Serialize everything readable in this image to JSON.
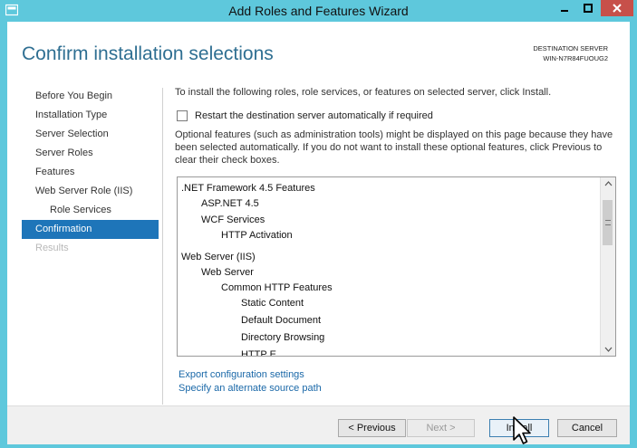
{
  "window": {
    "title": "Add Roles and Features Wizard"
  },
  "header": {
    "heading": "Confirm installation selections",
    "destination_label": "DESTINATION SERVER",
    "destination_server": "WIN-N7R84FUOUG2"
  },
  "nav": {
    "items": [
      {
        "label": "Before You Begin"
      },
      {
        "label": "Installation Type"
      },
      {
        "label": "Server Selection"
      },
      {
        "label": "Server Roles"
      },
      {
        "label": "Features"
      },
      {
        "label": "Web Server Role (IIS)"
      },
      {
        "label": "Role Services"
      },
      {
        "label": "Confirmation"
      },
      {
        "label": "Results"
      }
    ]
  },
  "content": {
    "intro": "To install the following roles, role services, or features on selected server, click Install.",
    "restart_checkbox_label": "Restart the destination server automatically if required",
    "note": "Optional features (such as administration tools) might be displayed on this page because they have been selected automatically. If you do not want to install these optional features, click Previous to clear their check boxes.",
    "list_items": [
      {
        "label": ".NET Framework 4.5 Features"
      },
      {
        "label": "ASP.NET 4.5"
      },
      {
        "label": "WCF Services"
      },
      {
        "label": "HTTP Activation"
      },
      {
        "label": "Web Server (IIS)"
      },
      {
        "label": "Web Server"
      },
      {
        "label": "Common HTTP Features"
      },
      {
        "label": "Static Content"
      },
      {
        "label": "Default Document"
      },
      {
        "label": "Directory Browsing"
      },
      {
        "label": "HTTP E..."
      }
    ],
    "links": {
      "export": "Export configuration settings",
      "alternate_source": "Specify an alternate source path"
    }
  },
  "buttons": {
    "previous": "< Previous",
    "next": "Next >",
    "install": "Install",
    "cancel": "Cancel"
  }
}
